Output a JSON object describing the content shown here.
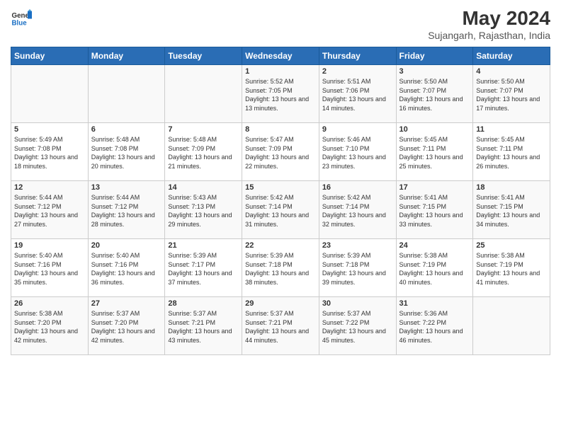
{
  "header": {
    "logo_general": "General",
    "logo_blue": "Blue",
    "month": "May 2024",
    "location": "Sujangarh, Rajasthan, India"
  },
  "days_of_week": [
    "Sunday",
    "Monday",
    "Tuesday",
    "Wednesday",
    "Thursday",
    "Friday",
    "Saturday"
  ],
  "weeks": [
    [
      {
        "day": "",
        "info": ""
      },
      {
        "day": "",
        "info": ""
      },
      {
        "day": "",
        "info": ""
      },
      {
        "day": "1",
        "info": "Sunrise: 5:52 AM\nSunset: 7:05 PM\nDaylight: 13 hours\nand 13 minutes."
      },
      {
        "day": "2",
        "info": "Sunrise: 5:51 AM\nSunset: 7:06 PM\nDaylight: 13 hours\nand 14 minutes."
      },
      {
        "day": "3",
        "info": "Sunrise: 5:50 AM\nSunset: 7:07 PM\nDaylight: 13 hours\nand 16 minutes."
      },
      {
        "day": "4",
        "info": "Sunrise: 5:50 AM\nSunset: 7:07 PM\nDaylight: 13 hours\nand 17 minutes."
      }
    ],
    [
      {
        "day": "5",
        "info": "Sunrise: 5:49 AM\nSunset: 7:08 PM\nDaylight: 13 hours\nand 18 minutes."
      },
      {
        "day": "6",
        "info": "Sunrise: 5:48 AM\nSunset: 7:08 PM\nDaylight: 13 hours\nand 20 minutes."
      },
      {
        "day": "7",
        "info": "Sunrise: 5:48 AM\nSunset: 7:09 PM\nDaylight: 13 hours\nand 21 minutes."
      },
      {
        "day": "8",
        "info": "Sunrise: 5:47 AM\nSunset: 7:09 PM\nDaylight: 13 hours\nand 22 minutes."
      },
      {
        "day": "9",
        "info": "Sunrise: 5:46 AM\nSunset: 7:10 PM\nDaylight: 13 hours\nand 23 minutes."
      },
      {
        "day": "10",
        "info": "Sunrise: 5:45 AM\nSunset: 7:11 PM\nDaylight: 13 hours\nand 25 minutes."
      },
      {
        "day": "11",
        "info": "Sunrise: 5:45 AM\nSunset: 7:11 PM\nDaylight: 13 hours\nand 26 minutes."
      }
    ],
    [
      {
        "day": "12",
        "info": "Sunrise: 5:44 AM\nSunset: 7:12 PM\nDaylight: 13 hours\nand 27 minutes."
      },
      {
        "day": "13",
        "info": "Sunrise: 5:44 AM\nSunset: 7:12 PM\nDaylight: 13 hours\nand 28 minutes."
      },
      {
        "day": "14",
        "info": "Sunrise: 5:43 AM\nSunset: 7:13 PM\nDaylight: 13 hours\nand 29 minutes."
      },
      {
        "day": "15",
        "info": "Sunrise: 5:42 AM\nSunset: 7:14 PM\nDaylight: 13 hours\nand 31 minutes."
      },
      {
        "day": "16",
        "info": "Sunrise: 5:42 AM\nSunset: 7:14 PM\nDaylight: 13 hours\nand 32 minutes."
      },
      {
        "day": "17",
        "info": "Sunrise: 5:41 AM\nSunset: 7:15 PM\nDaylight: 13 hours\nand 33 minutes."
      },
      {
        "day": "18",
        "info": "Sunrise: 5:41 AM\nSunset: 7:15 PM\nDaylight: 13 hours\nand 34 minutes."
      }
    ],
    [
      {
        "day": "19",
        "info": "Sunrise: 5:40 AM\nSunset: 7:16 PM\nDaylight: 13 hours\nand 35 minutes."
      },
      {
        "day": "20",
        "info": "Sunrise: 5:40 AM\nSunset: 7:16 PM\nDaylight: 13 hours\nand 36 minutes."
      },
      {
        "day": "21",
        "info": "Sunrise: 5:39 AM\nSunset: 7:17 PM\nDaylight: 13 hours\nand 37 minutes."
      },
      {
        "day": "22",
        "info": "Sunrise: 5:39 AM\nSunset: 7:18 PM\nDaylight: 13 hours\nand 38 minutes."
      },
      {
        "day": "23",
        "info": "Sunrise: 5:39 AM\nSunset: 7:18 PM\nDaylight: 13 hours\nand 39 minutes."
      },
      {
        "day": "24",
        "info": "Sunrise: 5:38 AM\nSunset: 7:19 PM\nDaylight: 13 hours\nand 40 minutes."
      },
      {
        "day": "25",
        "info": "Sunrise: 5:38 AM\nSunset: 7:19 PM\nDaylight: 13 hours\nand 41 minutes."
      }
    ],
    [
      {
        "day": "26",
        "info": "Sunrise: 5:38 AM\nSunset: 7:20 PM\nDaylight: 13 hours\nand 42 minutes."
      },
      {
        "day": "27",
        "info": "Sunrise: 5:37 AM\nSunset: 7:20 PM\nDaylight: 13 hours\nand 42 minutes."
      },
      {
        "day": "28",
        "info": "Sunrise: 5:37 AM\nSunset: 7:21 PM\nDaylight: 13 hours\nand 43 minutes."
      },
      {
        "day": "29",
        "info": "Sunrise: 5:37 AM\nSunset: 7:21 PM\nDaylight: 13 hours\nand 44 minutes."
      },
      {
        "day": "30",
        "info": "Sunrise: 5:37 AM\nSunset: 7:22 PM\nDaylight: 13 hours\nand 45 minutes."
      },
      {
        "day": "31",
        "info": "Sunrise: 5:36 AM\nSunset: 7:22 PM\nDaylight: 13 hours\nand 46 minutes."
      },
      {
        "day": "",
        "info": ""
      }
    ]
  ]
}
